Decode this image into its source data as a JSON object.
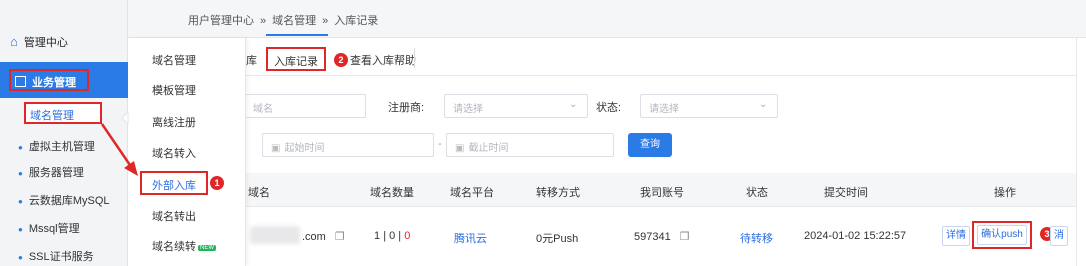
{
  "breadcrumb": [
    "用户管理中心",
    "»",
    "域名管理",
    "»",
    "入库记录"
  ],
  "sidebar": {
    "home_label": "管理中心",
    "business_label": "业务管理",
    "items": [
      "域名管理",
      "虚拟主机管理",
      "服务器管理",
      "云数据库MySQL",
      "Mssql管理",
      "SSL证书服务"
    ]
  },
  "flyout": {
    "items": [
      "域名管理",
      "模板管理",
      "离线注册",
      "域名转入",
      "外部入库",
      "域名转出",
      "域名续转"
    ],
    "new_badge": "NEW"
  },
  "tabs": {
    "partial": "库",
    "active": "入库记录",
    "help": "查看入库帮助"
  },
  "badges": [
    "1",
    "2",
    "3"
  ],
  "filters": {
    "domain_placeholder": "域名",
    "registrar_label": "注册商:",
    "registrar_placeholder": "请选择",
    "status_label": "状态:",
    "status_placeholder": "请选择",
    "start_placeholder": "起始时间",
    "separator": "-",
    "end_placeholder": "截止时间",
    "query_button": "查询"
  },
  "table": {
    "headers": [
      "域名",
      "域名数量",
      "域名平台",
      "转移方式",
      "我司账号",
      "状态",
      "提交时间",
      "操作"
    ],
    "row": {
      "domain": ".com",
      "count_a": "1",
      "count_sep1": "|",
      "count_b": "0",
      "count_sep2": "|",
      "count_c": "0",
      "platform": "腾讯云",
      "transfer": "0元Push",
      "account": "597341",
      "status": "待转移",
      "time": "2024-01-02 15:22:57",
      "detail_btn": "详情",
      "push_btn": "确认push",
      "cancel_btn": "消"
    }
  },
  "colors": {
    "accent": "#2b7be6",
    "highlight": "#e02727",
    "count_zero": "#e02727"
  }
}
